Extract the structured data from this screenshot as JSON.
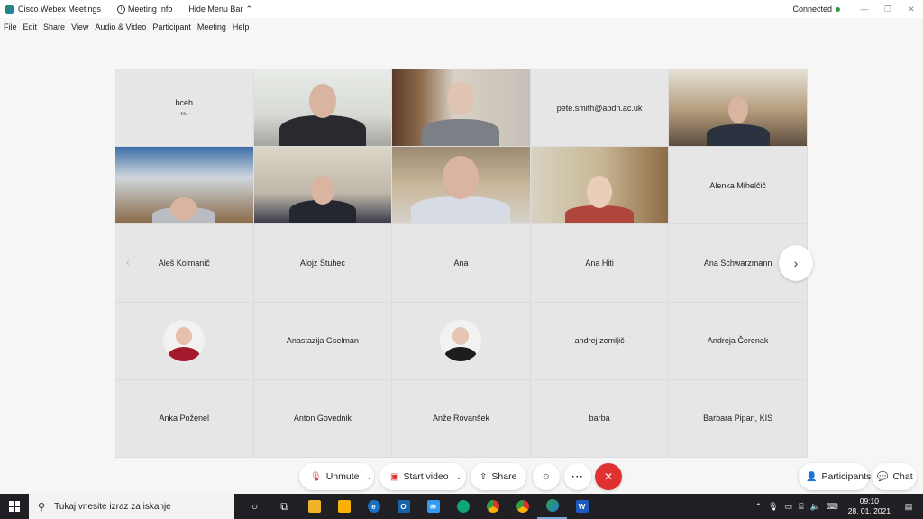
{
  "titlebar": {
    "app_title": "Cisco Webex Meetings",
    "meeting_info": "Meeting Info",
    "hide_menu": "Hide Menu Bar",
    "status": "Connected"
  },
  "menu": [
    "File",
    "Edit",
    "Share",
    "View",
    "Audio & Video",
    "Participant",
    "Meeting",
    "Help"
  ],
  "grid": {
    "tiles": [
      {
        "name": "bceh",
        "sub": "Me"
      },
      {
        "name": ""
      },
      {
        "name": ""
      },
      {
        "name": "pete.smith@abdn.ac.uk"
      },
      {
        "name": ""
      },
      {
        "name": ""
      },
      {
        "name": ""
      },
      {
        "name": ""
      },
      {
        "name": ""
      },
      {
        "name": "Alenka Mihelčič"
      },
      {
        "name": "Aleš Kolmanič"
      },
      {
        "name": "Alojz Štuhec"
      },
      {
        "name": "Ana"
      },
      {
        "name": "Ana Hiti"
      },
      {
        "name": "Ana Schwarzmann"
      },
      {
        "name": ""
      },
      {
        "name": "Anastazija Gselman"
      },
      {
        "name": ""
      },
      {
        "name": "andrej zemljič"
      },
      {
        "name": "Andreja Čerenak"
      },
      {
        "name": "Anka Poženel"
      },
      {
        "name": "Anton Govednik"
      },
      {
        "name": "Anže Rovanšek"
      },
      {
        "name": "barba"
      },
      {
        "name": "Barbara Pipan, KIS"
      }
    ]
  },
  "controls": {
    "unmute": "Unmute",
    "start_video": "Start video",
    "share": "Share",
    "participants": "Participants",
    "chat": "Chat"
  },
  "taskbar": {
    "search_placeholder": "Tukaj vnesite izraz za iskanje",
    "time": "09:10",
    "date": "28. 01. 2021"
  }
}
